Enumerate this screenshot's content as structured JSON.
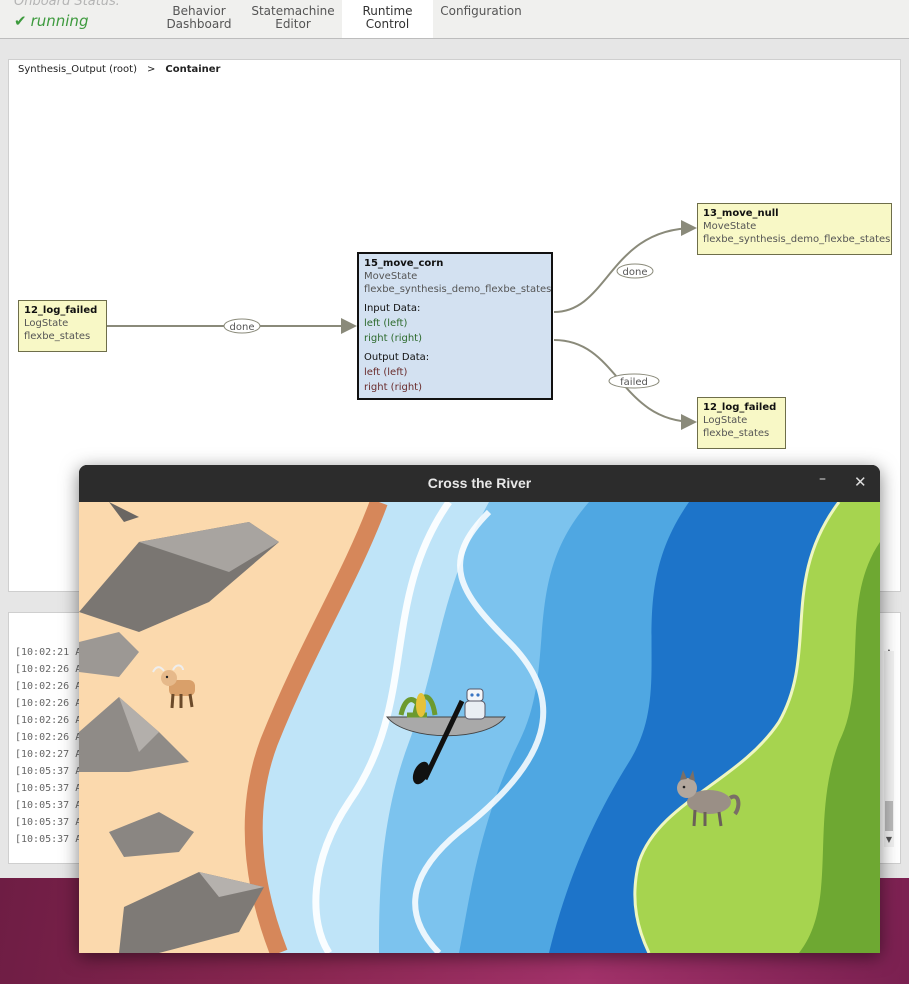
{
  "topbar": {
    "onboard_label": "Onboard Status:",
    "onboard_status": "running",
    "tabs": [
      {
        "line1": "Behavior",
        "line2": "Dashboard"
      },
      {
        "line1": "Statemachine",
        "line2": "Editor"
      },
      {
        "line1": "Runtime",
        "line2": "Control"
      },
      {
        "line1": "Configuration",
        "line2": ""
      }
    ],
    "active_tab": "Runtime Control"
  },
  "breadcrumb": {
    "root": "Synthesis_Output (root)",
    "separator": ">",
    "current": "Container"
  },
  "states": {
    "log_failed_left": {
      "name": "12_log_failed",
      "type": "LogState",
      "package": "flexbe_states"
    },
    "move_corn": {
      "name": "15_move_corn",
      "type": "MoveState",
      "package": "flexbe_synthesis_demo_flexbe_states",
      "input_label": "Input Data:",
      "input_1": "left (left)",
      "input_2": "right (right)",
      "output_label": "Output Data:",
      "output_1": "left (left)",
      "output_2": "right (right)"
    },
    "move_null": {
      "name": "13_move_null",
      "type": "MoveState",
      "package": "flexbe_synthesis_demo_flexbe_states"
    },
    "log_failed_right": {
      "name": "12_log_failed",
      "type": "LogState",
      "package": "flexbe_states"
    }
  },
  "edges": {
    "left_to_corn": "done",
    "corn_to_null": "done",
    "corn_to_failed": "failed"
  },
  "log": {
    "lines": [
      "[10:02:21 A",
      "[10:02:26 A",
      "[10:02:26 A",
      "[10:02:26 A",
      "[10:02:26 A",
      "[10:02:26 A",
      "[10:02:27 A",
      "[10:05:37 A",
      "[10:05:37 A",
      "[10:05:37 A",
      "[10:05:37 A",
      "[10:05:37 A"
    ]
  },
  "game": {
    "title": "Cross the River",
    "minimize_glyph": "–",
    "close_glyph": "✕",
    "entities": [
      "goat",
      "boat",
      "corn",
      "robot",
      "paddle",
      "wolf"
    ]
  },
  "colors": {
    "state_fill": "#f8f8c6",
    "active_state_fill": "#d3e1f1",
    "status_green": "#3d9a3d",
    "sand": "#fbd9ad",
    "river_light": "#bfe4f8",
    "river_mid": "#5bb0e6",
    "river_deep": "#1a73c9",
    "grass": "#a6d44f"
  }
}
